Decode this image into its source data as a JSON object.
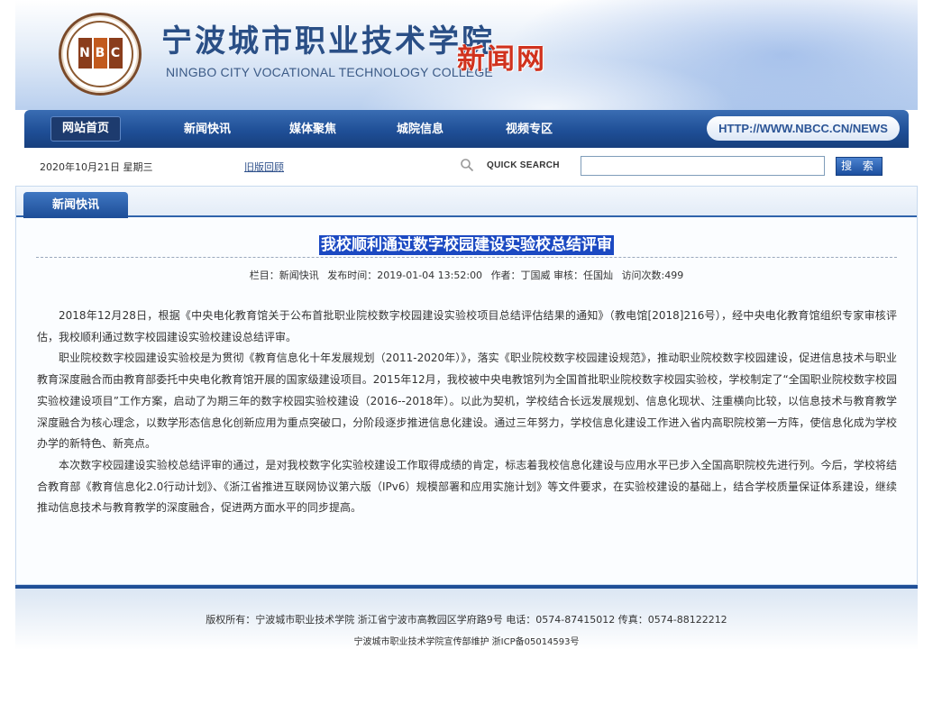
{
  "header": {
    "logo_text": "NBCC",
    "title_cn": "宁波城市职业技术学院",
    "title_en": "NINGBO CITY VOCATIONAL TECHNOLOGY COLLEGE",
    "news_label": "新闻网"
  },
  "nav": {
    "items": [
      {
        "label": "网站首页"
      },
      {
        "label": "新闻快讯"
      },
      {
        "label": "媒体聚焦"
      },
      {
        "label": "城院信息"
      },
      {
        "label": "视频专区"
      }
    ],
    "url": "HTTP://WWW.NBCC.CN/NEWS"
  },
  "toolbar": {
    "date": "2020年10月21日 星期三",
    "old_version": "旧版回顾",
    "search_label": "QUICK SEARCH",
    "search_value": "",
    "search_button": "搜 索"
  },
  "panel": {
    "tab_label": "新闻快讯",
    "article_title": "我校顺利通过数字校园建设实验校总结评审",
    "meta": {
      "column": "栏目：新闻快讯",
      "published": "发布时间：2019-01-04 13:52:00",
      "author": "作者：丁国威 审核：任国灿",
      "views": "访问次数:499"
    },
    "paragraphs": [
      "2018年12月28日，根据《中央电化教育馆关于公布首批职业院校数字校园建设实验校项目总结评估结果的通知》（教电馆[2018]216号），经中央电化教育馆组织专家审核评估，我校顺利通过数字校园建设实验校建设总结评审。",
      "职业院校数字校园建设实验校是为贯彻《教育信息化十年发展规划（2011-2020年）》，落实《职业院校数字校园建设规范》，推动职业院校数字校园建设，促进信息技术与职业教育深度融合而由教育部委托中央电化教育馆开展的国家级建设项目。2015年12月，我校被中央电教馆列为全国首批职业院校数字校园实验校，学校制定了“全国职业院校数字校园实验校建设项目”工作方案，启动了为期三年的数字校园实验校建设（2016--2018年）。以此为契机，学校结合长远发展规划、信息化现状、注重横向比较，以信息技术与教育教学深度融合为核心理念，以数学形态信息化创新应用为重点突破口，分阶段逐步推进信息化建设。通过三年努力，学校信息化建设工作进入省内高职院校第一方阵，使信息化成为学校办学的新特色、新亮点。",
      "本次数字校园建设实验校总结评审的通过，是对我校数字化实验校建设工作取得成绩的肯定，标志着我校信息化建设与应用水平已步入全国高职院校先进行列。今后，学校将结合教育部《教育信息化2.0行动计划》、《浙江省推进互联网协议第六版（IPv6）规模部署和应用实施计划》等文件要求，在实验校建设的基础上，结合学校质量保证体系建设，继续推动信息技术与教育教学的深度融合，促进两方面水平的同步提高。"
    ]
  },
  "footer": {
    "line1": "版权所有：宁波城市职业技术学院 浙江省宁波市高教园区学府路9号 电话：0574-87415012 传真：0574-88122212",
    "line2": "宁波城市职业技术学院宣传部维护 浙ICP备05014593号"
  },
  "colors": {
    "nav_blue": "#1f4f97",
    "title_highlight": "#1b49c2",
    "news_red": "#d0321e"
  }
}
